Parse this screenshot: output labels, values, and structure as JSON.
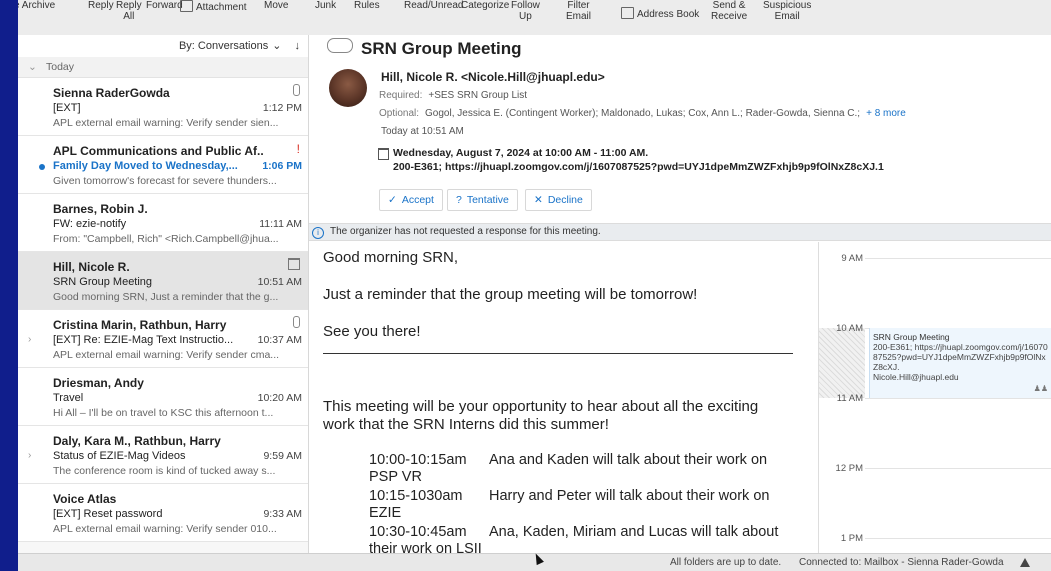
{
  "toolbar": {
    "buttons": [
      {
        "l1": "e Archive",
        "l2": ""
      },
      {
        "l1": "Reply",
        "l2": ""
      },
      {
        "l1": "Reply",
        "l2": "All"
      },
      {
        "l1": "Forward",
        "l2": ""
      },
      {
        "l1": "Attachment",
        "l2": ""
      },
      {
        "l1": "Move",
        "l2": ""
      },
      {
        "l1": "Junk",
        "l2": ""
      },
      {
        "l1": "Rules",
        "l2": ""
      },
      {
        "l1": "Read/Unread",
        "l2": ""
      },
      {
        "l1": "Categorize",
        "l2": ""
      },
      {
        "l1": "Follow",
        "l2": "Up"
      },
      {
        "l1": "Filter",
        "l2": "Email"
      },
      {
        "l1": "Address Book",
        "l2": ""
      },
      {
        "l1": "Send &",
        "l2": "Receive"
      },
      {
        "l1": "Suspicious",
        "l2": "Email"
      }
    ]
  },
  "list": {
    "sort_label": "By: Conversations",
    "sort_caret": "⌄",
    "sort_arrow": "↓",
    "group_label": "Today",
    "items": [
      {
        "sender": "Sienna RaderGowda",
        "subject": "[EXT]",
        "time": "1:12 PM",
        "preview": "APL external email warning: Verify sender sien..."
      },
      {
        "sender": "APL Communications and Public Af...",
        "subject": "Family Day Moved to Wednesday,...",
        "time": "1:06 PM",
        "preview": "Given tomorrow's forecast for severe thunders...",
        "flag": "!"
      },
      {
        "sender": "Barnes, Robin J.",
        "subject": "FW: ezie-notify",
        "time": "11:11 AM",
        "preview": "From: \"Campbell, Rich\" <Rich.Campbell@jhua..."
      },
      {
        "sender": "Hill, Nicole R.",
        "subject": "SRN Group Meeting",
        "time": "10:51 AM",
        "preview": "Good morning SRN, Just a reminder that the g..."
      },
      {
        "sender": "Cristina Marin, Rathbun, Harry",
        "subject": "[EXT] Re: EZIE-Mag Text Instructio...",
        "time": "10:37 AM",
        "preview": "APL external email warning: Verify sender cma..."
      },
      {
        "sender": "Driesman, Andy",
        "subject": "Travel",
        "time": "10:20 AM",
        "preview": "Hi All – I'll be on travel to KSC this afternoon t..."
      },
      {
        "sender": "Daly, Kara M., Rathbun, Harry",
        "subject": "Status of EZIE-Mag Videos",
        "time": "9:59 AM",
        "preview": "The conference room is kind of tucked away s..."
      },
      {
        "sender": "Voice Atlas",
        "subject": "[EXT] Reset password",
        "time": "9:33 AM",
        "preview": "APL external email warning: Verify sender 010..."
      }
    ]
  },
  "message": {
    "subject": "SRN Group Meeting",
    "from": "Hill, Nicole R. <Nicole.Hill@jhuapl.edu>",
    "required_label": "Required:",
    "required": "+SES SRN Group List",
    "optional_label": "Optional:",
    "optional": "Gogol, Jessica E. (Contingent Worker);   Maldonado, Lukas;   Cox, Ann L.;   Rader-Gowda, Sienna C.;",
    "more": "+ 8 more",
    "sent": "Today at 10:51 AM",
    "when": "Wednesday, August 7, 2024 at 10:00 AM - 11:00 AM.",
    "where": "200-E361; https://jhuapl.zoomgov.com/j/1607087525?pwd=UYJ1dpeMmZWZFxhjb9p9fOlNxZ8cXJ.1",
    "accept": "Accept",
    "tentative": "Tentative",
    "decline": "Decline",
    "notice": "The organizer has not requested a response for this meeting.",
    "body": {
      "greeting": "Good morning SRN,",
      "reminder": "Just a reminder that the group meeting will be tomorrow!",
      "see_you": "See you there!",
      "intro_1": "This meeting will be your opportunity to hear about all the exciting",
      "intro_2": "work that the SRN Interns did this summer!",
      "schedule": [
        {
          "time": "10:00-10:15am",
          "text": "Ana and Kaden will talk about their work on",
          "cont": "PSP VR"
        },
        {
          "time": "10:15-1030am",
          "text": "Harry and Peter will talk about their work on",
          "cont": "EZIE"
        },
        {
          "time": "10:30-10:45am",
          "text": "Ana, Kaden, Miriam and Lucas will talk about",
          "cont": "their work on LSII"
        }
      ]
    }
  },
  "calendar": {
    "hours": [
      "9 AM",
      "10 AM",
      "11 AM",
      "12 PM",
      "1 PM"
    ],
    "event_title": "SRN Group Meeting",
    "event_loc": "200-E361; https://jhuapl.zoomgov.com/j/1607087525?pwd=UYJ1dpeMmZWZFxhjb9p9fOlNxZ8cXJ.",
    "event_org": "Nicole.Hill@jhuapl.edu"
  },
  "status": {
    "sync": "All folders are up to date.",
    "connected": "Connected to: Mailbox - Sienna Rader-Gowda"
  },
  "colors": {
    "accent": "#1a73c8",
    "desktop": "#101e8c"
  }
}
